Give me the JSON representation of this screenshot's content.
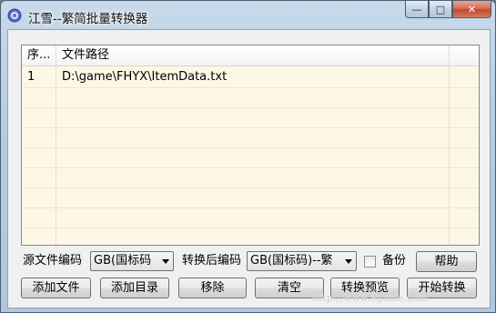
{
  "window": {
    "title": "江雪--繁简批量转换器",
    "minimize_glyph": "—",
    "maximize_glyph": "□",
    "close_glyph": "✕"
  },
  "list": {
    "columns": [
      "序...",
      "文件路径"
    ],
    "rows": [
      {
        "seq": "1",
        "path": "D:\\game\\FHYX\\ItemData.txt"
      }
    ]
  },
  "options": {
    "source_encoding_label": "源文件编码",
    "source_encoding_value": "GB(国标码",
    "target_encoding_label": "转换后编码",
    "target_encoding_value": "GB(国标码)--繁",
    "backup_label": "备份",
    "backup_checked": false,
    "help_label": "帮助"
  },
  "buttons": {
    "add_file": "添加文件",
    "add_dir": "添加目录",
    "remove": "移除",
    "clear": "清空",
    "preview": "转换预览",
    "start": "开始转换"
  },
  "watermark": "http://www.9game.com"
}
